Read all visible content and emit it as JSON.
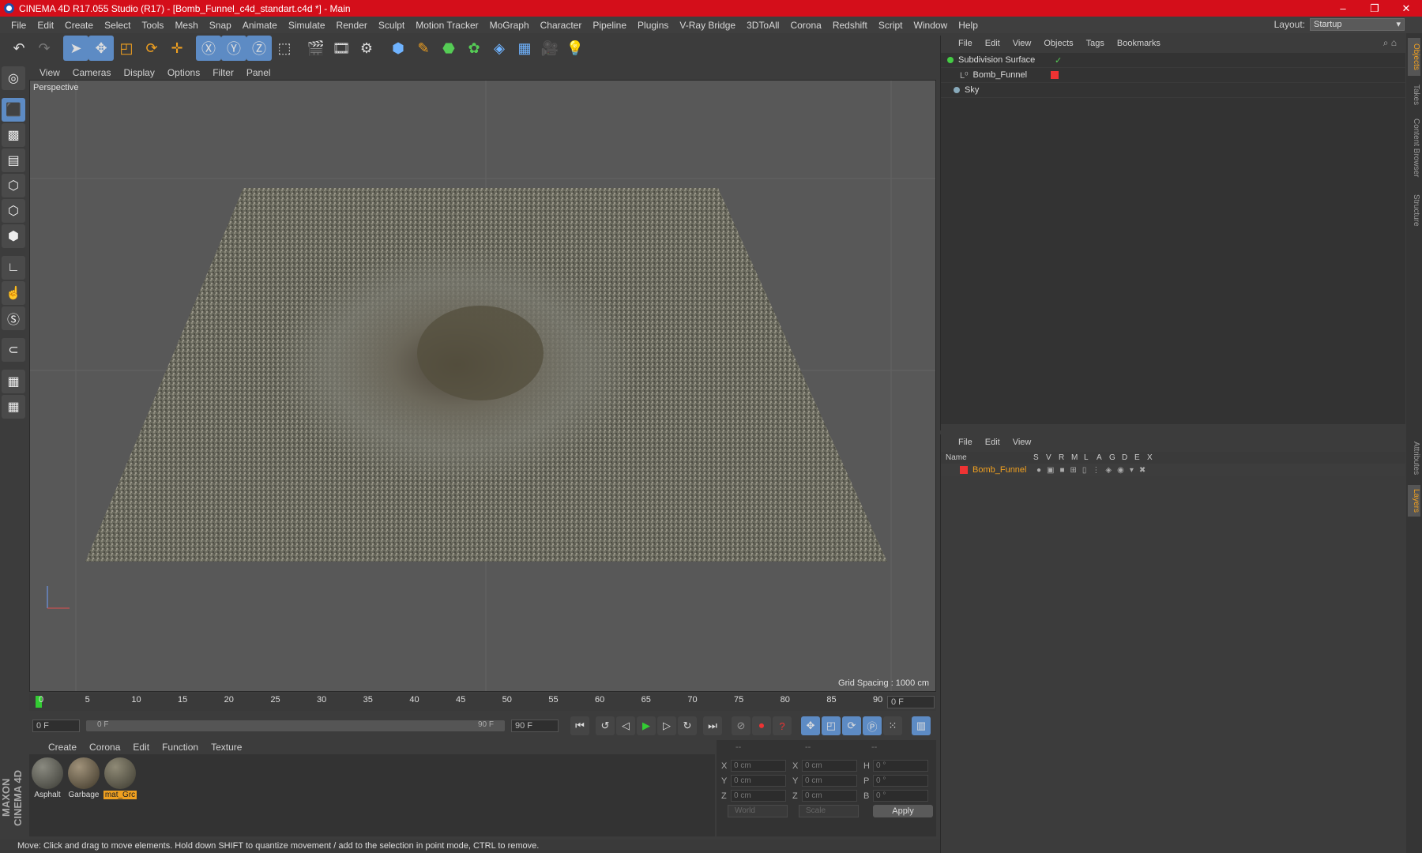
{
  "window": {
    "title": "CINEMA 4D R17.055 Studio (R17) - [Bomb_Funnel_c4d_standart.c4d *] - Main",
    "minimize": "–",
    "restore": "❐",
    "close": "✕"
  },
  "menu": [
    "File",
    "Edit",
    "Create",
    "Select",
    "Tools",
    "Mesh",
    "Snap",
    "Animate",
    "Simulate",
    "Render",
    "Sculpt",
    "Motion Tracker",
    "MoGraph",
    "Character",
    "Pipeline",
    "Plugins",
    "V-Ray Bridge",
    "3DToAll",
    "Corona",
    "Redshift",
    "Script",
    "Window",
    "Help"
  ],
  "layout": {
    "label": "Layout:",
    "value": "Startup"
  },
  "viewport": {
    "menu": [
      "View",
      "Cameras",
      "Display",
      "Options",
      "Filter",
      "Panel"
    ],
    "label": "Perspective",
    "grid_info": "Grid Spacing : 1000 cm"
  },
  "timeline": {
    "ticks": [
      "0",
      "5",
      "10",
      "15",
      "20",
      "25",
      "30",
      "35",
      "40",
      "45",
      "50",
      "55",
      "60",
      "65",
      "70",
      "75",
      "80",
      "85",
      "90"
    ],
    "current": "0 F"
  },
  "playback": {
    "start": "0 F",
    "range_start": "0 F",
    "range_end": "90 F",
    "end": "90 F"
  },
  "materials": {
    "menu": [
      "Create",
      "Corona",
      "Edit",
      "Function",
      "Texture"
    ],
    "items": [
      {
        "name": "Asphalt"
      },
      {
        "name": "Garbage"
      },
      {
        "name": "mat_Grc"
      }
    ]
  },
  "coords": {
    "headers": [
      "--",
      "--",
      "--"
    ],
    "rows": [
      {
        "a": "X",
        "av": "0 cm",
        "b": "X",
        "bv": "0 cm",
        "c": "H",
        "cv": "0 °"
      },
      {
        "a": "Y",
        "av": "0 cm",
        "b": "Y",
        "bv": "0 cm",
        "c": "P",
        "cv": "0 °"
      },
      {
        "a": "Z",
        "av": "0 cm",
        "b": "Z",
        "bv": "0 cm",
        "c": "B",
        "cv": "0 °"
      }
    ],
    "world": "World",
    "scale": "Scale",
    "apply": "Apply"
  },
  "status": "Move: Click and drag to move elements. Hold down SHIFT to quantize movement / add to the selection in point mode, CTRL to remove.",
  "brand": "MAXON CINEMA 4D",
  "objects": {
    "menu": [
      "File",
      "Edit",
      "View",
      "Objects",
      "Tags",
      "Bookmarks"
    ],
    "items": [
      {
        "name": "Subdivision Surface"
      },
      {
        "name": "Bomb_Funnel"
      },
      {
        "name": "Sky"
      }
    ]
  },
  "layers": {
    "menu": [
      "File",
      "Edit",
      "View"
    ],
    "name_header": "Name",
    "cols": [
      "S",
      "V",
      "R",
      "M",
      "L",
      "A",
      "G",
      "D",
      "E",
      "X"
    ],
    "row": "Bomb_Funnel"
  },
  "sidetabs": [
    "Objects",
    "Takes",
    "Content Browser",
    "Structure",
    "Attributes",
    "Layers"
  ]
}
